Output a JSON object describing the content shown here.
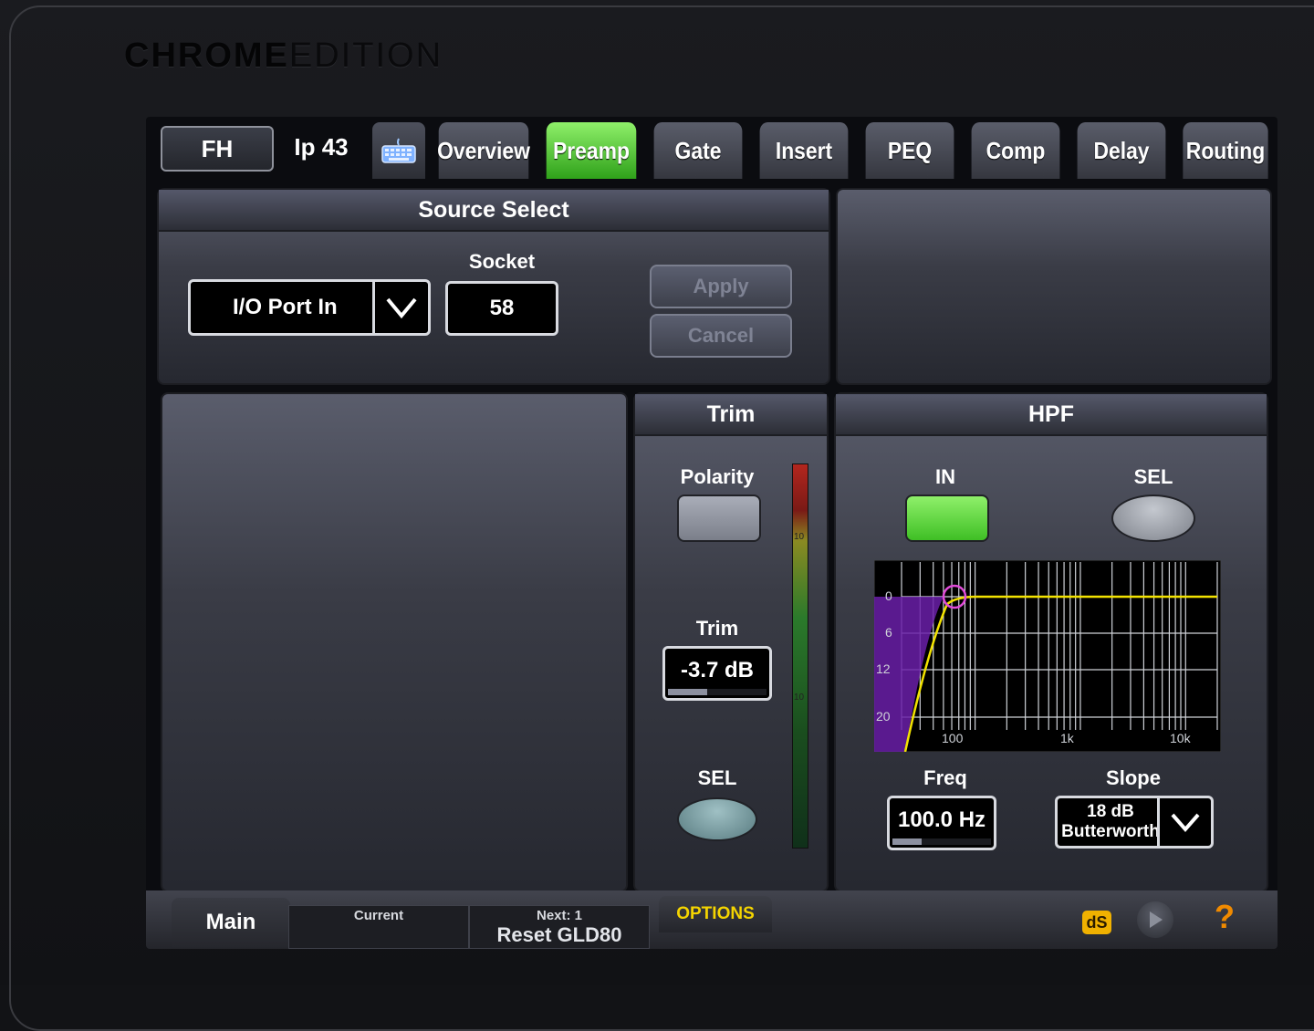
{
  "brand": {
    "bold": "CHROME",
    "thin": "EDITION"
  },
  "header": {
    "channel_label": "FH",
    "input_label": "Ip 43"
  },
  "tabs": [
    {
      "label": "Overview",
      "active": false
    },
    {
      "label": "Preamp",
      "active": true
    },
    {
      "label": "Gate",
      "active": false
    },
    {
      "label": "Insert",
      "active": false
    },
    {
      "label": "PEQ",
      "active": false
    },
    {
      "label": "Comp",
      "active": false
    },
    {
      "label": "Delay",
      "active": false
    },
    {
      "label": "Routing",
      "active": false
    }
  ],
  "source_select": {
    "title": "Source Select",
    "source_value": "I/O Port In",
    "socket_label": "Socket",
    "socket_value": "58",
    "apply_label": "Apply",
    "cancel_label": "Cancel"
  },
  "trim": {
    "title": "Trim",
    "polarity_label": "Polarity",
    "trim_label": "Trim",
    "trim_value": "-3.7 dB",
    "trim_fraction": 0.4,
    "sel_label": "SEL",
    "meter_marks": [
      "10",
      "10"
    ]
  },
  "hpf": {
    "title": "HPF",
    "in_label": "IN",
    "sel_label": "SEL",
    "freq_label": "Freq",
    "freq_value": "100.0 Hz",
    "freq_fraction": 0.3,
    "slope_label": "Slope",
    "slope_line1": "18 dB",
    "slope_line2": "Butterworth",
    "graph": {
      "y_ticks": [
        "0",
        "6",
        "12",
        "20"
      ],
      "x_ticks": [
        "100",
        "1k",
        "10k"
      ]
    }
  },
  "footer": {
    "main_label": "Main",
    "current_label": "Current",
    "next_label": "Next: 1",
    "next_scene": "Reset GLD80",
    "options_label": "OPTIONS",
    "ds_label": "dS",
    "help_label": "?"
  },
  "colors": {
    "active_green": "#4fd631",
    "filter_yellow": "#f2e200",
    "filter_fill": "#6a1fa8",
    "options_yellow": "#f4d400",
    "help_orange": "#f08a00"
  }
}
